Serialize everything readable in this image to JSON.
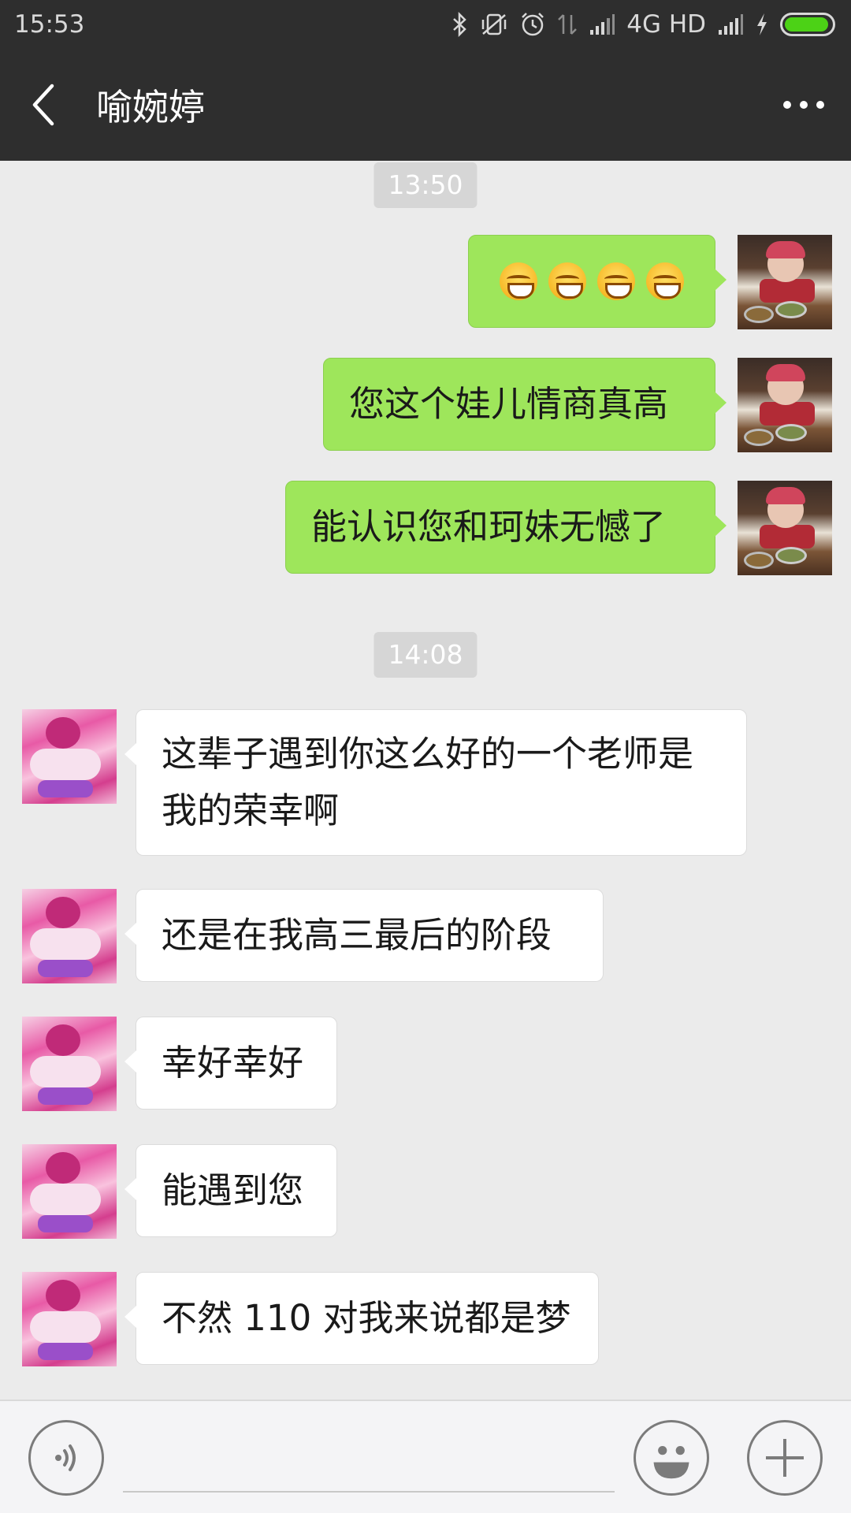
{
  "status_bar": {
    "time": "15:53",
    "network": "4G HD",
    "battery_level": 0.95,
    "battery_color": "#4cd216",
    "icons": [
      "bluetooth-icon",
      "vibrate-off-icon",
      "alarm-icon",
      "data-arrows-icon",
      "signal-icon",
      "signal-icon",
      "charging-icon",
      "battery-icon"
    ]
  },
  "header": {
    "title": "喻婉婷",
    "back_icon": "chevron-left-icon",
    "more_icon": "more-dots-icon"
  },
  "colors": {
    "header_bg": "#2e2e2e",
    "chat_bg": "#ebebeb",
    "outgoing_bubble": "#9ee65b",
    "incoming_bubble": "#ffffff"
  },
  "chat": {
    "timestamps": [
      "13:50",
      "14:08"
    ],
    "outgoing": [
      {
        "type": "emoji",
        "emoji": "grinning-face-emoji",
        "count": 4
      },
      {
        "type": "text",
        "text": "您这个娃儿情商真高"
      },
      {
        "type": "text",
        "text": "能认识您和珂妹无憾了"
      }
    ],
    "incoming": [
      {
        "line1": "这辈子遇到你这么好的一个老师是",
        "line2": "我的荣幸啊"
      },
      {
        "text": "还是在我高三最后的阶段"
      },
      {
        "text": "幸好幸好"
      },
      {
        "text": "能遇到您"
      },
      {
        "text": "不然 110 对我来说都是梦"
      }
    ]
  },
  "input_bar": {
    "voice_icon": "voice-icon",
    "emoji_icon": "smiley-icon",
    "add_icon": "plus-icon",
    "placeholder": ""
  }
}
